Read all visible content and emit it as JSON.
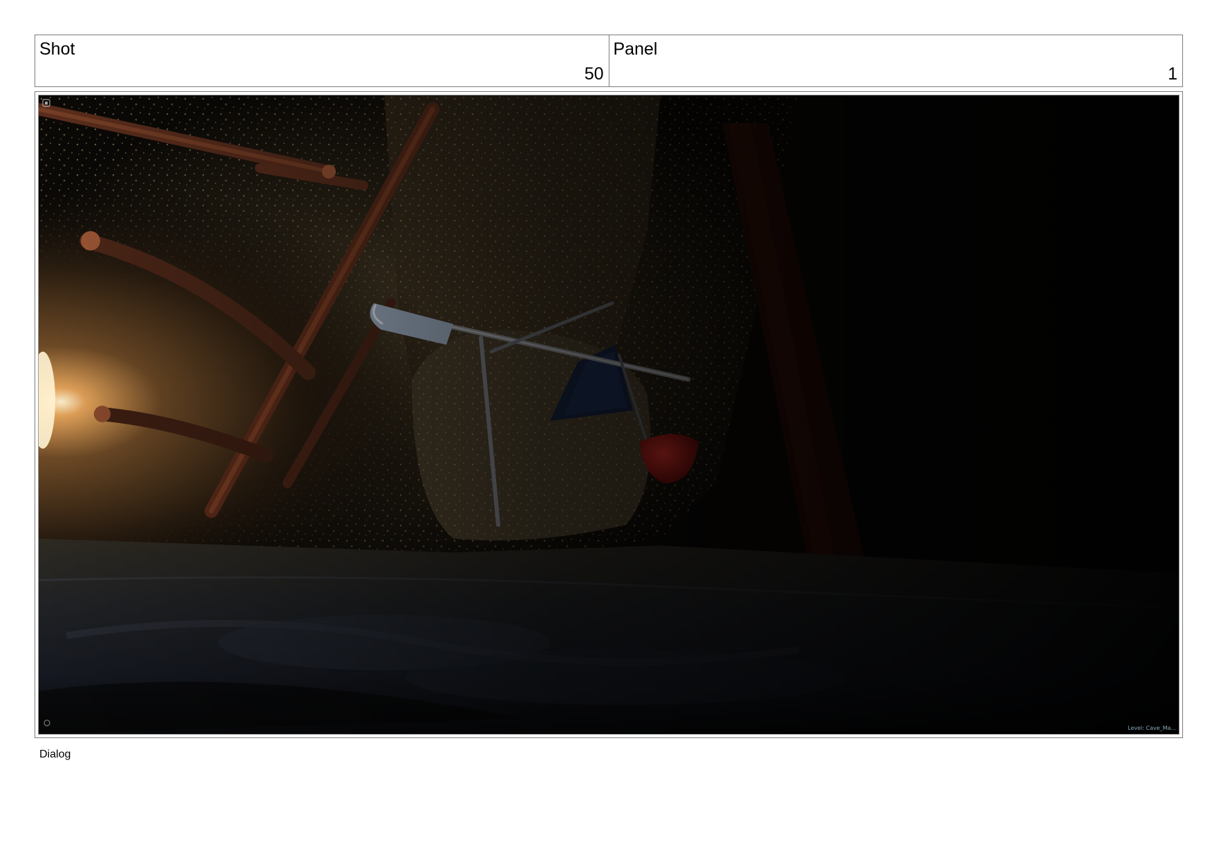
{
  "header": {
    "shot_label": "Shot",
    "shot_value": "50",
    "panel_label": "Panel",
    "panel_value": "1"
  },
  "frame": {
    "scene": "dark-cave-interior-with-folding-chair",
    "hud_icon_top": "camera-icon",
    "hud_icon_bottom": "settings-icon",
    "hud_level_text": "Level: Cave_Ma..."
  },
  "footer": {
    "dialog_label": "Dialog"
  }
}
